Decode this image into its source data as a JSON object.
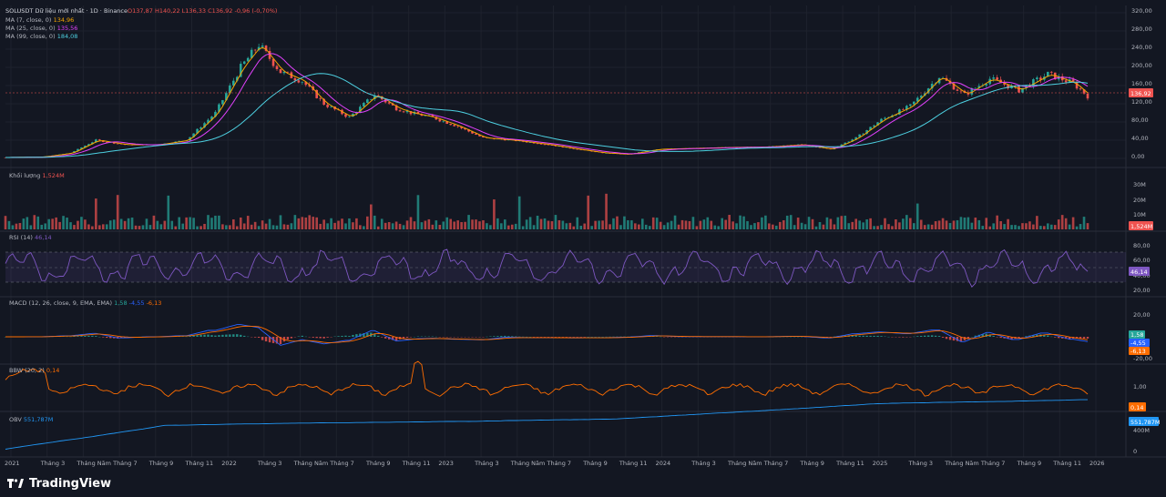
{
  "header": {
    "symbol_line": "SOLUSDT Dữ liệu mới nhất · 1D · Binance",
    "ohlc": {
      "open": "O137,87",
      "high": "H140,22",
      "low": "L136,33",
      "close": "C136,92",
      "change": "-0,96 (-0,70%)"
    },
    "ma7": {
      "label": "MA (7, close, 0)",
      "value": "134,96"
    },
    "ma25": {
      "label": "MA (25, close, 0)",
      "value": "135,56"
    },
    "ma99": {
      "label": "MA (99, close, 0)",
      "value": "184,08"
    }
  },
  "price_axis": {
    "ticks": [
      "320,00",
      "280,00",
      "240,00",
      "200,00",
      "160,00",
      "120,00",
      "80,00",
      "40,00",
      "0,00"
    ],
    "current": "136,92"
  },
  "volume": {
    "label": "Khối lượng",
    "value": "1,524M",
    "ticks": [
      "30M",
      "20M",
      "10M"
    ]
  },
  "rsi": {
    "label": "RSI (14)",
    "value": "46,14",
    "ticks": [
      "80,00",
      "60,00",
      "40,00",
      "20,00"
    ],
    "current": "46,14"
  },
  "macd": {
    "label": "MACD (12, 26, close, 9, EMA, EMA)",
    "v1": "1,58",
    "v2": "-4,55",
    "v3": "-6,13",
    "ticks": [
      "20,00",
      "-20,00"
    ]
  },
  "bbw": {
    "label": "BBW (20, 2)",
    "value": "0,14",
    "ticks": [
      "1,00"
    ],
    "current": "0,14"
  },
  "obv": {
    "label": "OBV",
    "value": "551,787M",
    "ticks": [
      "400M",
      "0"
    ],
    "current": "551,787M"
  },
  "time_axis": [
    "2021",
    "Tháng 3",
    "Tháng Năm",
    "Tháng 7",
    "Tháng 9",
    "Tháng 11",
    "2022",
    "Tháng 3",
    "Tháng Năm",
    "Tháng 7",
    "Tháng 9",
    "Tháng 11",
    "2023",
    "Tháng 3",
    "Tháng Năm",
    "Tháng 7",
    "Tháng 9",
    "Tháng 11",
    "2024",
    "Tháng 3",
    "Tháng Năm",
    "Tháng 7",
    "Tháng 9",
    "Tháng 11",
    "2025",
    "Tháng 3",
    "Tháng Năm",
    "Tháng 7",
    "Tháng 9",
    "Tháng 11",
    "2026"
  ],
  "brand": "TradingView",
  "colors": {
    "bg": "#131722",
    "up": "#26a69a",
    "down": "#ef5350",
    "ma7": "#f7a600",
    "ma25": "#e040fb",
    "ma99": "#4dd0e1",
    "rsi": "#7e57c2",
    "macd": "#2962ff",
    "signal": "#ff6d00",
    "bbw": "#ff6d00",
    "obv": "#2196f3"
  }
}
